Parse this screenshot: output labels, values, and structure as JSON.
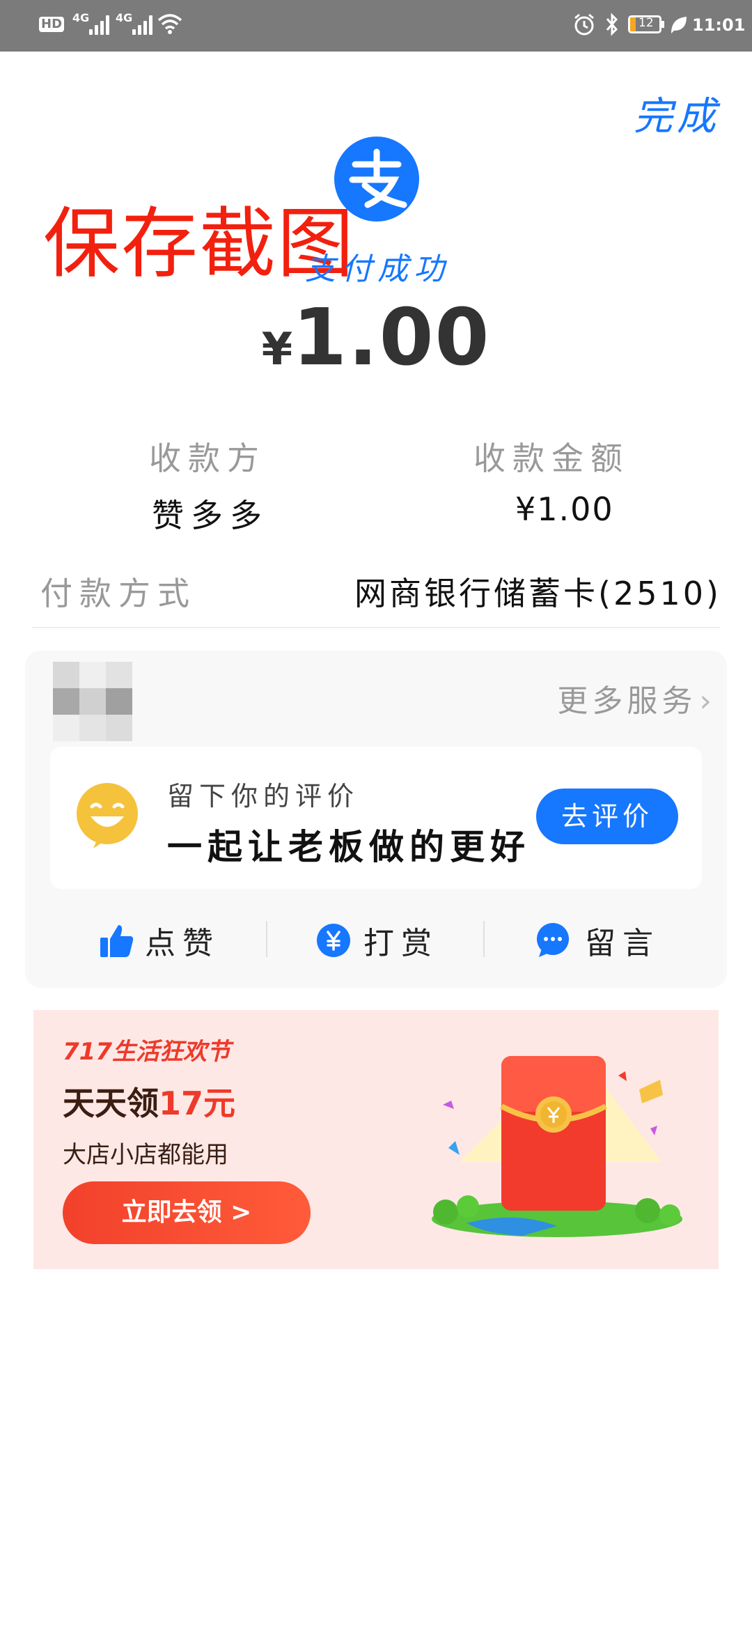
{
  "status_bar": {
    "left_badge": "HD",
    "network_1": "4G",
    "network_2": "4G",
    "battery": "12",
    "time": "11:01"
  },
  "header": {
    "done_label": "完成",
    "watermark": "保存截图",
    "success_text": "支付成功",
    "amount_symbol": "¥",
    "amount": "1.00"
  },
  "payment_info": {
    "payee_label": "收款方",
    "payee_value": "赞多多",
    "amount_label": "收款金额",
    "amount_value": "¥1.00",
    "method_label": "付款方式",
    "method_value": "网商银行储蓄卡(2510)"
  },
  "services": {
    "more_label": "更多服务",
    "review_title": "留下你的评价",
    "review_main": "一起让老板做的更好",
    "review_button": "去评价",
    "actions": [
      {
        "label": "点赞",
        "icon": "thumbs-up-icon"
      },
      {
        "label": "打赏",
        "icon": "yuan-coin-icon"
      },
      {
        "label": "留言",
        "icon": "chat-bubble-icon"
      }
    ]
  },
  "promo": {
    "tag": "717生活狂欢节",
    "title_prefix": "天天领",
    "title_highlight": "17元",
    "subtitle": "大店小店都能用",
    "button": "立即去领 >"
  },
  "colors": {
    "accent": "#1677ff",
    "watermark_red": "#f2200e",
    "promo_bg": "#fde8e6",
    "promo_red": "#ee3a2a"
  }
}
